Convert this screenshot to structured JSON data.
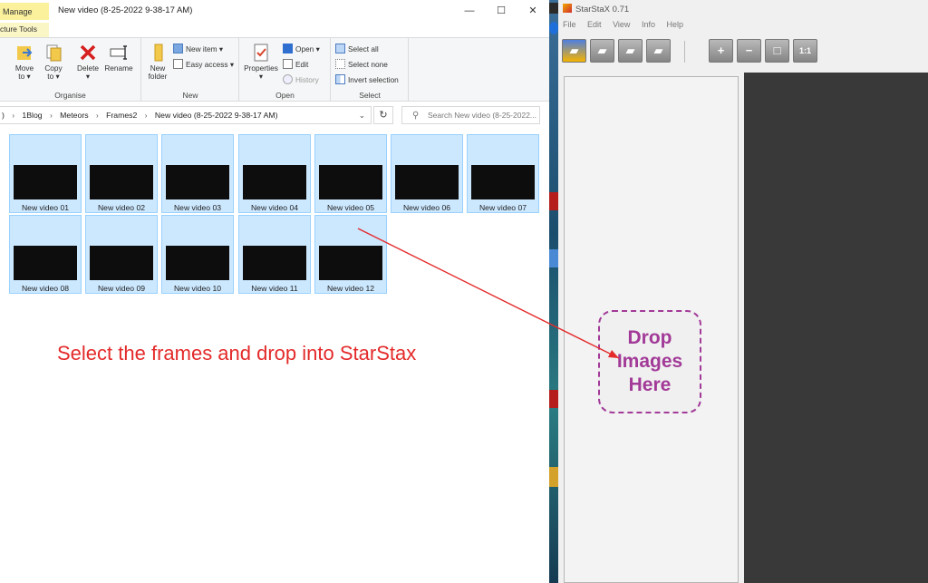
{
  "explorer": {
    "tab_manage": "Manage",
    "subtab": "cture Tools",
    "title": "New video (8-25-2022 9-38-17 AM)",
    "window_buttons": {
      "minimize": "—",
      "maximize": "☐",
      "close": "✕"
    },
    "ribbon": {
      "organise": {
        "label": "Organise",
        "move_to": "Move\nto ▾",
        "copy_to": "Copy\nto ▾",
        "delete": "Delete\n▾",
        "rename": "Rename"
      },
      "new": {
        "label": "New",
        "new_folder": "New\nfolder",
        "new_item": "New item ▾",
        "easy_access": "Easy access ▾"
      },
      "open": {
        "label": "Open",
        "properties": "Properties\n▾",
        "open": "Open ▾",
        "edit": "Edit",
        "history": "History"
      },
      "select": {
        "label": "Select",
        "select_all": "Select all",
        "select_none": "Select none",
        "invert_selection": "Invert selection"
      }
    },
    "address": {
      "crumbs": [
        ")",
        "1Blog",
        "Meteors",
        "Frames2",
        "New video (8-25-2022 9-38-17 AM)"
      ],
      "search_placeholder": "Search New video (8-25-2022..."
    },
    "files": [
      "New video 01",
      "New video 02",
      "New video 03",
      "New video 04",
      "New video 05",
      "New video 06",
      "New video 07",
      "New video 08",
      "New video 09",
      "New video 10",
      "New video 11",
      "New video 12"
    ]
  },
  "annotation": {
    "instruction": "Select the frames and drop into StarStax",
    "arrow_color": "#e42a2a"
  },
  "starstax": {
    "title": "StarStaX 0.71",
    "menu": [
      "File",
      "Edit",
      "View",
      "Info",
      "Help"
    ],
    "zoom_actual_label": "1:1",
    "dropzone_text": "Drop\nImages\nHere",
    "dropzone_color": "#a23a98",
    "preview_color": "#393939"
  },
  "colors": {
    "selection_fill": "#cce8ff",
    "selection_border": "#99d1ff",
    "manage_tab": "#fbf19d"
  }
}
